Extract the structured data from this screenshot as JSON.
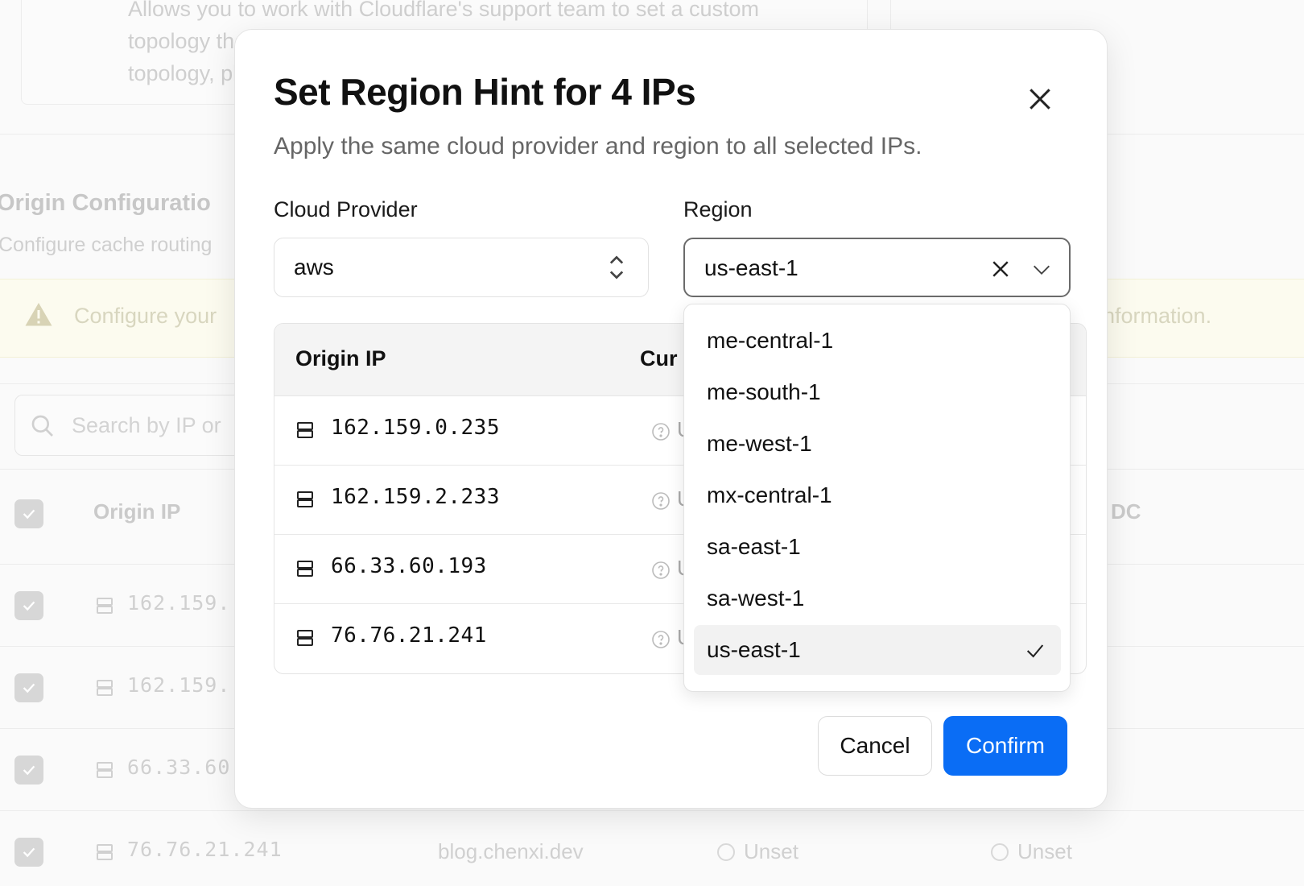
{
  "background": {
    "card_desc_lines": [
      "Allows you to work with Cloudflare's support team to set a custom",
      "topology tha",
      "topology, ple"
    ],
    "section_title": "Origin Configuratio",
    "section_subtitle": "Configure cache routing",
    "warning_text": "Configure your",
    "warning_text_end": "nformation.",
    "search_placeholder": "Search by IP or",
    "table_headers": {
      "origin_ip": "Origin IP",
      "dc": "DC"
    },
    "rows": [
      {
        "ip": "162.159."
      },
      {
        "ip": "162.159."
      },
      {
        "ip": "66.33.60"
      },
      {
        "ip": "76.76.21.241",
        "host": "blog.chenxi.dev",
        "status1": "Unset",
        "status2": "Unset"
      }
    ]
  },
  "modal": {
    "title": "Set Region Hint for 4 IPs",
    "subtitle": "Apply the same cloud provider and region to all selected IPs.",
    "provider": {
      "label": "Cloud Provider",
      "value": "aws"
    },
    "region": {
      "label": "Region",
      "value": "us-east-1"
    },
    "table": {
      "headers": {
        "origin_ip": "Origin IP",
        "current": "Cur"
      },
      "rows": [
        {
          "ip": "162.159.0.235",
          "status": "U"
        },
        {
          "ip": "162.159.2.233",
          "status": "U"
        },
        {
          "ip": "66.33.60.193",
          "status": "U"
        },
        {
          "ip": "76.76.21.241",
          "status": "U"
        }
      ]
    },
    "dropdown": {
      "options": [
        "me-central-1",
        "me-south-1",
        "me-west-1",
        "mx-central-1",
        "sa-east-1",
        "sa-west-1",
        "us-east-1"
      ],
      "selected": "us-east-1"
    },
    "buttons": {
      "cancel": "Cancel",
      "confirm": "Confirm"
    }
  },
  "colors": {
    "primary": "#0a6df5",
    "warning_bg": "#fcfbef"
  }
}
